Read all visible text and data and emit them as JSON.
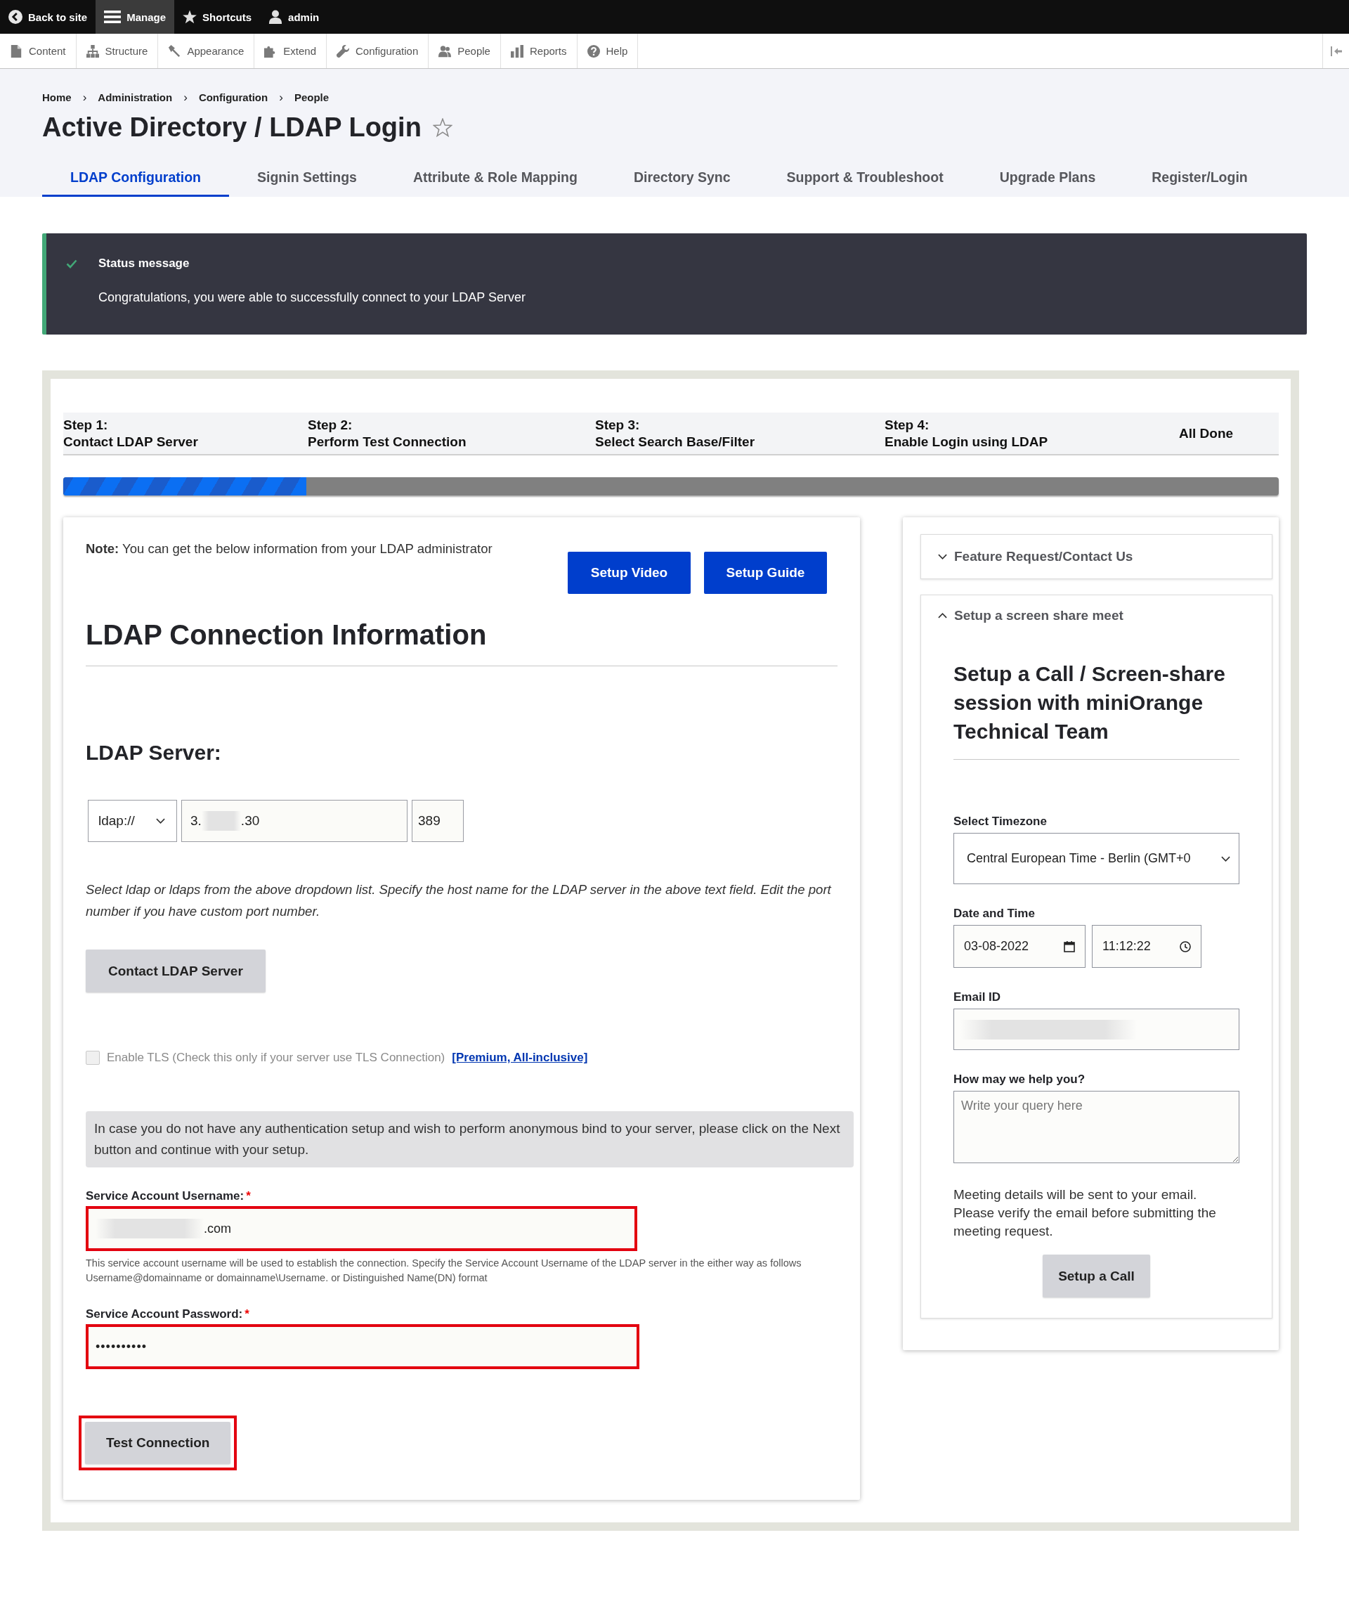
{
  "toolbar": {
    "items": [
      {
        "label": "Back to site",
        "kind": "back",
        "selected": false
      },
      {
        "label": "Manage",
        "kind": "menu",
        "selected": true
      },
      {
        "label": "Shortcuts",
        "kind": "star",
        "selected": false
      },
      {
        "label": "admin",
        "kind": "user",
        "selected": false
      }
    ]
  },
  "admin_menu": {
    "items": [
      {
        "label": "Content",
        "kind": "content"
      },
      {
        "label": "Structure",
        "kind": "structure"
      },
      {
        "label": "Appearance",
        "kind": "appearance"
      },
      {
        "label": "Extend",
        "kind": "extend"
      },
      {
        "label": "Configuration",
        "kind": "configuration"
      },
      {
        "label": "People",
        "kind": "people"
      },
      {
        "label": "Reports",
        "kind": "reports"
      },
      {
        "label": "Help",
        "kind": "help"
      }
    ]
  },
  "breadcrumb": {
    "separator": "›",
    "items": [
      "Home",
      "Administration",
      "Configuration",
      "People"
    ]
  },
  "page_title": "Active Directory / LDAP Login",
  "tabs": [
    {
      "label": "LDAP Configuration",
      "selected": true
    },
    {
      "label": "Signin Settings",
      "selected": false
    },
    {
      "label": "Attribute & Role Mapping",
      "selected": false
    },
    {
      "label": "Directory Sync",
      "selected": false
    },
    {
      "label": "Support & Troubleshoot",
      "selected": false
    },
    {
      "label": "Upgrade Plans",
      "selected": false
    },
    {
      "label": "Register/Login",
      "selected": false
    }
  ],
  "status_message": {
    "title": "Status message",
    "text": "Congratulations, you were able to successfully connect to your LDAP Server"
  },
  "wizard": {
    "steps": [
      {
        "label": "Step 1:",
        "title": "Contact LDAP Server"
      },
      {
        "label": "Step 2:",
        "title": "Perform Test Connection"
      },
      {
        "label": "Step 3:",
        "title": "Select Search Base/Filter"
      },
      {
        "label": "Step 4:",
        "title": "Enable Login using LDAP"
      },
      {
        "title": "All Done"
      }
    ],
    "progress": {
      "level": 0.2
    }
  },
  "connection_panel": {
    "note": "**Note:** You can get the below information from your LDAP administrator",
    "buttons": [
      "Setup Video",
      "Setup Guide"
    ],
    "heading": "LDAP Connection Information",
    "server": {
      "heading": "LDAP Server:",
      "protocol": "ldap://",
      "host_prefix": "3.",
      "host_suffix": ".30",
      "host_redacted": true,
      "port": "389",
      "hint": "Select ldap or ldaps from the above dropdown list. Specify the host name for the LDAP server in the above text field. Edit the port number if you have custom port number."
    },
    "contact_button": "Contact LDAP Server",
    "tls": {
      "label": "Enable TLS (Check this only if your server use TLS Connection)",
      "link": "[Premium, All-inclusive]",
      "checked": false,
      "disabled": true
    },
    "info": "In case you do not have any authentication setup and wish to perform anonymous bind to your server, please click on the Next button and continue with your setup.",
    "username": {
      "label": "Service Account Username:",
      "required_mark": "*",
      "value": ".com",
      "redacted": true,
      "highlighted": true,
      "hint": "This service account username will be used to establish the connection. Specify the Service Account Username of the LDAP server in the either way as follows Username@domainname or domainname\\Username. or Distinguished Name(DN) format"
    },
    "password": {
      "label": "Service Account Password:",
      "required_mark": "*",
      "value": "••••••••••",
      "highlighted": true
    },
    "test_button": {
      "label": "Test Connection",
      "highlighted": true
    }
  },
  "support_panel": {
    "sections": [
      {
        "title": "Feature Request/Contact Us",
        "expanded": false
      },
      {
        "title": "Setup a screen share meet",
        "expanded": true,
        "content": {
          "heading": "Setup a Call / Screen-share session with miniOrange Technical Team",
          "timezone": {
            "label": "Select Timezone",
            "value": "Central European Time - Berlin (GMT+0"
          },
          "datetime": {
            "label": "Date and Time",
            "date": "03-08-2022",
            "time": "11:12:22"
          },
          "email": {
            "label": "Email ID",
            "redacted": true
          },
          "query": {
            "label": "How may we help you?",
            "placeholder": "Write your query here"
          },
          "note": "Meeting details will be sent to your email. Please verify the email before submitting the meeting request.",
          "button": "Setup a Call"
        }
      }
    ]
  }
}
